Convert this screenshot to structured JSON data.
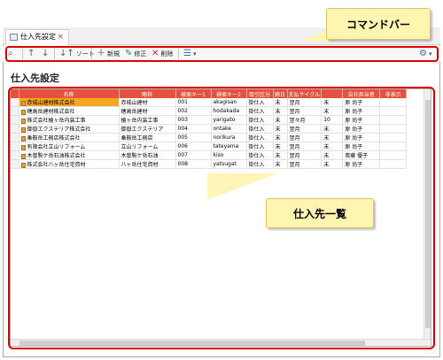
{
  "tab": {
    "label": "仕入先設定",
    "close": "×"
  },
  "toolbar": {
    "sort_label": "ソート",
    "new_label": "新規",
    "edit_label": "修正",
    "delete_label": "削除"
  },
  "page_title": "仕入先設定",
  "callouts": {
    "command_bar": "コマンドバー",
    "list": "仕入先一覧"
  },
  "table": {
    "columns": [
      "名称",
      "略称",
      "検索キー1",
      "検索キー2",
      "取引区分",
      "締日",
      "支払サイクル",
      "",
      "自社担当者",
      "非表示"
    ],
    "rows": [
      [
        "赤城山建材株式会社",
        "赤城山建材",
        "001",
        "akagisan",
        "掛仕入",
        "末",
        "翌月",
        "末",
        "原 尚子",
        ""
      ],
      [
        "穂高岳建材株式会社",
        "穂高岳建材",
        "002",
        "hodakada",
        "掛仕入",
        "末",
        "翌月",
        "末",
        "原 尚子",
        ""
      ],
      [
        "株式会社槍ヶ岳内装工事",
        "槍ヶ岳内装工事",
        "003",
        "yarigato",
        "掛仕入",
        "末",
        "翌々月",
        "10",
        "原 尚子",
        ""
      ],
      [
        "御嶽エクステリア株式会社",
        "御嶽エクステリア",
        "004",
        "ontake",
        "掛仕入",
        "末",
        "翌月",
        "末",
        "原 尚子",
        ""
      ],
      [
        "乗鞍岳工務店株式会社",
        "乗鞍岳工務店",
        "005",
        "norikura",
        "掛仕入",
        "末",
        "翌月",
        "末",
        "原 尚子",
        ""
      ],
      [
        "有限会社立山リフォーム",
        "立山リフォーム",
        "006",
        "tateyama",
        "掛仕入",
        "末",
        "翌月",
        "末",
        "原 尚子",
        ""
      ],
      [
        "木曽駒ケ岳石油株式会社",
        "木曽駒ケ岳石油",
        "007",
        "kiso",
        "掛仕入",
        "末",
        "翌月",
        "末",
        "斎藤 優子",
        ""
      ],
      [
        "株式会社八ヶ岳住宅資材",
        "八ヶ岳住宅資材",
        "008",
        "yatsugat",
        "掛仕入",
        "末",
        "翌月",
        "末",
        "原 尚子",
        ""
      ]
    ]
  }
}
